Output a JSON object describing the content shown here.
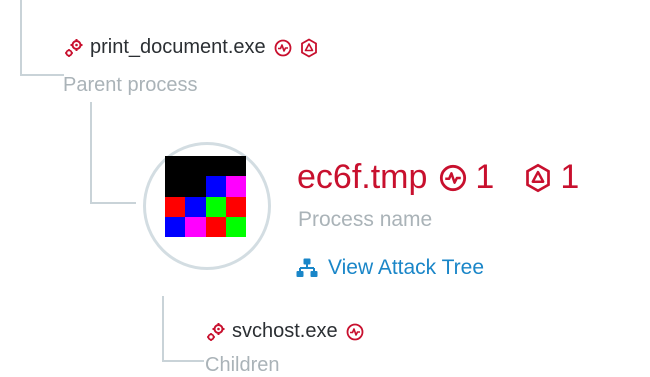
{
  "parent": {
    "name": "print_document.exe",
    "label": "Parent process",
    "icons": [
      "gears-icon",
      "activity-badge-icon",
      "hex-alert-badge-icon"
    ]
  },
  "process": {
    "name": "ec6f.tmp",
    "activity_count": "1",
    "alert_count": "1",
    "label": "Process name",
    "thumbnail_colors": [
      "#000000",
      "#000000",
      "#000000",
      "#000000",
      "#000000",
      "#000000",
      "#0000ff",
      "#ff00ff",
      "#ff0000",
      "#0000ff",
      "#00ff00",
      "#ff0000",
      "#0000ff",
      "#ff00ff",
      "#ff0000",
      "#00ff00"
    ]
  },
  "link": {
    "label": "View Attack Tree",
    "icon": "hierarchy-icon"
  },
  "child": {
    "name": "svchost.exe",
    "label": "Children",
    "icons": [
      "gears-icon",
      "activity-badge-icon"
    ]
  },
  "colors": {
    "alert_red": "#c8102e",
    "link_blue": "#1a86c8",
    "muted_gray": "#aab3b8",
    "tree_line": "#c9d3d8"
  }
}
